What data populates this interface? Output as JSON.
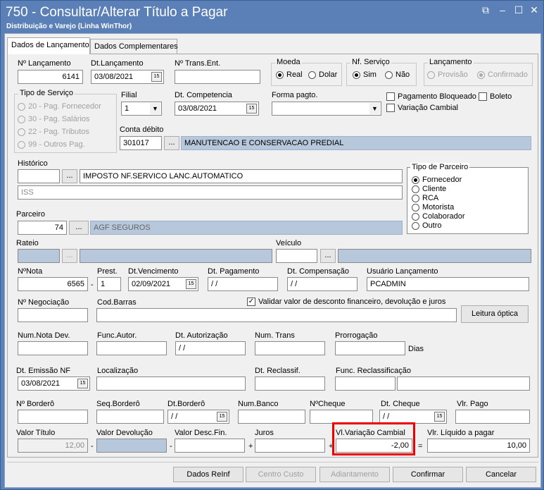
{
  "window": {
    "title": "750 - Consultar/Alterar Título a Pagar",
    "subtitle": "Distribuição e Varejo (Linha WinThor)"
  },
  "tabs": [
    "Dados de Lançamento",
    "Dados Complementares"
  ],
  "nlanc": {
    "label": "Nº Lançamento",
    "value": "6141"
  },
  "dtlanc": {
    "label": "Dt.Lançamento",
    "value": "03/08/2021"
  },
  "ntrans": {
    "label": "Nº Trans.Ent.",
    "value": ""
  },
  "moeda": {
    "label": "Moeda",
    "opt1": "Real",
    "opt2": "Dolar"
  },
  "nfserv": {
    "label": "Nf. Serviço",
    "opt1": "Sim",
    "opt2": "Não"
  },
  "lancamento": {
    "label": "Lançamento",
    "opt1": "Provisão",
    "opt2": "Confirmado"
  },
  "tiposerv": {
    "label": "Tipo de Serviço",
    "items": [
      "20 - Pag. Fornecedor",
      "30 - Pag. Salários",
      "22 - Pag. Tributos",
      "99 - Outros Pag."
    ]
  },
  "filial": {
    "label": "Filial",
    "value": "1"
  },
  "dtcomp": {
    "label": "Dt. Competencia",
    "value": "03/08/2021"
  },
  "formapg": {
    "label": "Forma pagto.",
    "value": ""
  },
  "pagbloq": "Pagamento Bloqueado",
  "boleto": "Boleto",
  "varcamb": "Variação Cambial",
  "contadeb": {
    "label": "Conta débito",
    "code": "301017",
    "desc": "MANUTENCAO E CONSERVACAO PREDIAL"
  },
  "historico": {
    "label": "Histórico",
    "code": "",
    "text": "IMPOSTO NF.SERVICO LANC.AUTOMATICO",
    "text2": "ISS"
  },
  "tipoparc": {
    "label": "Tipo de Parceiro",
    "items": [
      "Fornecedor",
      "Cliente",
      "RCA",
      "Motorista",
      "Colaborador",
      "Outro"
    ]
  },
  "parceiro": {
    "label": "Parceiro",
    "code": "74",
    "name": "AGF SEGUROS"
  },
  "rateio": {
    "label": "Rateio"
  },
  "veiculo": {
    "label": "Veículo"
  },
  "nota": {
    "label": "NºNota",
    "value": "6565"
  },
  "prest": {
    "label": "Prest.",
    "value": "1"
  },
  "dtvenc": {
    "label": "Dt.Vencimento",
    "value": "02/09/2021"
  },
  "dtpag": {
    "label": "Dt. Pagamento",
    "value": " / /"
  },
  "dtcompens": {
    "label": "Dt. Compensação",
    "value": " / /"
  },
  "usuario": {
    "label": "Usuário Lançamento",
    "value": "PCADMIN"
  },
  "negoc": {
    "label": "Nº Negociação",
    "value": ""
  },
  "codbarras": {
    "label": "Cod.Barras",
    "value": ""
  },
  "validar": "Validar valor de desconto financeiro,  devolução e juros",
  "leitura": "Leitura óptica",
  "numnotadev": {
    "label": "Num.Nota Dev."
  },
  "funcautor": {
    "label": "Func.Autor."
  },
  "dtautor": {
    "label": "Dt. Autorização",
    "value": " / /"
  },
  "numtrans": {
    "label": "Num. Trans"
  },
  "prorrog": {
    "label": "Prorrogação",
    "unit": "Dias"
  },
  "dtemissao": {
    "label": "Dt. Emissão NF",
    "value": "03/08/2021"
  },
  "localizacao": {
    "label": "Localização"
  },
  "dtreclass": {
    "label": "Dt. Reclassif."
  },
  "funcreclass": {
    "label": "Func. Reclassificação"
  },
  "bordero": {
    "label": "Nº Borderô"
  },
  "seqbordero": {
    "label": "Seq.Borderô"
  },
  "dtbordero": {
    "label": "Dt.Borderô",
    "value": " / /"
  },
  "numbanco": {
    "label": "Num.Banco"
  },
  "ncheque": {
    "label": "NºCheque"
  },
  "dtcheque": {
    "label": "Dt. Cheque",
    "value": " / /"
  },
  "vlrpago": {
    "label": "Vlr. Pago"
  },
  "valortitulo": {
    "label": "Valor Título",
    "value": "12,00"
  },
  "valordev": {
    "label": "Valor Devolução"
  },
  "valordesc": {
    "label": "Valor Desc.Fin."
  },
  "juros": {
    "label": "Juros"
  },
  "vlvar": {
    "label": "Vl.Variação Cambial",
    "value": "-2,00"
  },
  "vlliq": {
    "label": "Vlr. Líquido a pagar",
    "value": "10,00"
  },
  "ops": {
    "minus": "-",
    "plus": "+",
    "eq": "="
  },
  "buttons": {
    "reinf": "Dados ReInf",
    "centro": "Centro Custo",
    "adiant": "Adiantamento",
    "confirmar": "Confirmar",
    "cancelar": "Cancelar"
  }
}
